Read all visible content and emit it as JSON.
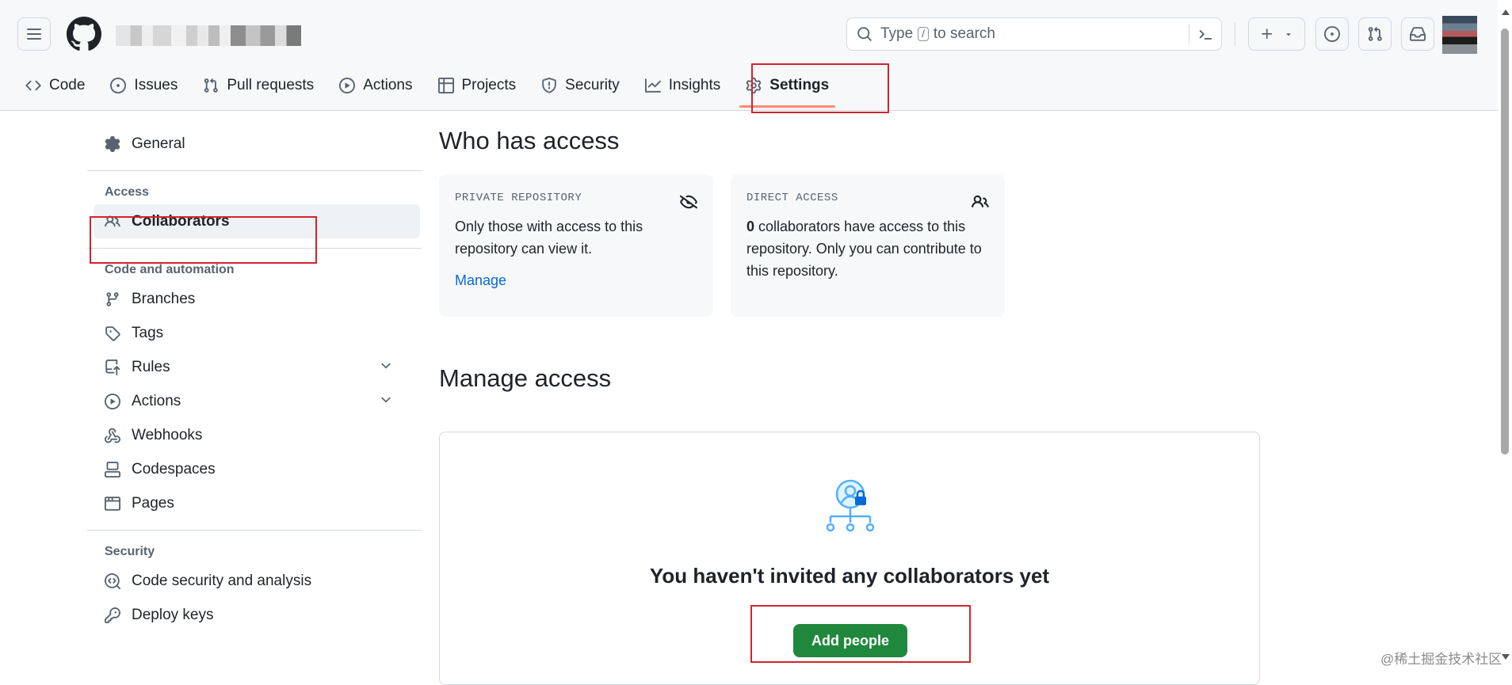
{
  "header": {
    "search": {
      "prefix": "Type",
      "key": "/",
      "suffix": "to search"
    }
  },
  "tabs": [
    {
      "label": "Code",
      "icon": "code-icon"
    },
    {
      "label": "Issues",
      "icon": "issue-icon"
    },
    {
      "label": "Pull requests",
      "icon": "pull-request-icon"
    },
    {
      "label": "Actions",
      "icon": "play-icon"
    },
    {
      "label": "Projects",
      "icon": "table-icon"
    },
    {
      "label": "Security",
      "icon": "shield-icon"
    },
    {
      "label": "Insights",
      "icon": "graph-icon"
    },
    {
      "label": "Settings",
      "icon": "gear-icon",
      "active": true
    }
  ],
  "sidebar": {
    "general": "General",
    "access_heading": "Access",
    "collaborators": "Collaborators",
    "code_heading": "Code and automation",
    "items": [
      "Branches",
      "Tags",
      "Rules",
      "Actions",
      "Webhooks",
      "Codespaces",
      "Pages"
    ],
    "security_heading": "Security",
    "security_items": [
      "Code security and analysis",
      "Deploy keys"
    ]
  },
  "main": {
    "who_title": "Who has access",
    "private_card": {
      "caption": "PRIVATE REPOSITORY",
      "text": "Only those with access to this repository can view it.",
      "link": "Manage"
    },
    "direct_card": {
      "caption": "DIRECT ACCESS",
      "count": "0",
      "text": " collaborators have access to this repository. Only you can contribute to this repository."
    },
    "manage_title": "Manage access",
    "empty_text": "You haven't invited any collaborators yet",
    "add_button": "Add people"
  },
  "watermark": "@稀土掘金技术社区",
  "colors": {
    "accent": "#0969da",
    "button_green": "#1f883d",
    "highlight_box": "#d1242f",
    "active_tab_underline": "#fd8c73"
  }
}
